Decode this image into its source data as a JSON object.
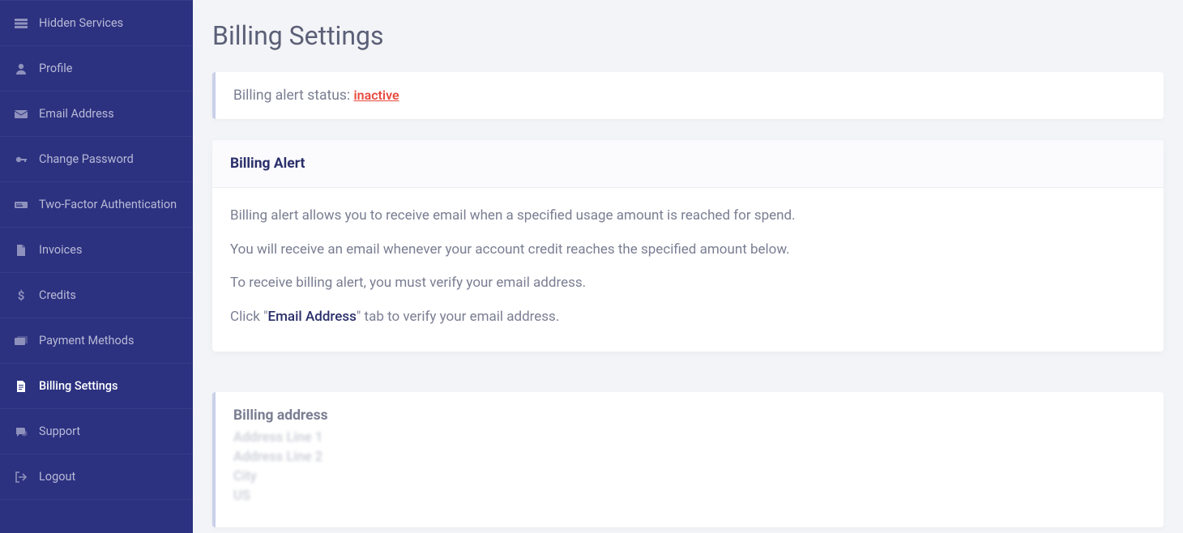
{
  "sidebar": {
    "items": [
      {
        "label": "Hidden Services",
        "icon": "server-icon",
        "active": false
      },
      {
        "label": "Profile",
        "icon": "user-icon",
        "active": false
      },
      {
        "label": "Email Address",
        "icon": "envelope-icon",
        "active": false
      },
      {
        "label": "Change Password",
        "icon": "key-icon",
        "active": false
      },
      {
        "label": "Two-Factor Authentication",
        "icon": "keyboard-icon",
        "active": false
      },
      {
        "label": "Invoices",
        "icon": "file-icon",
        "active": false
      },
      {
        "label": "Credits",
        "icon": "dollar-icon",
        "active": false
      },
      {
        "label": "Payment Methods",
        "icon": "cards-icon",
        "active": false
      },
      {
        "label": "Billing Settings",
        "icon": "document-icon",
        "active": true
      },
      {
        "label": "Support",
        "icon": "chat-icon",
        "active": false
      },
      {
        "label": "Logout",
        "icon": "logout-icon",
        "active": false
      }
    ]
  },
  "page": {
    "title": "Billing Settings",
    "alert_status_label": "Billing alert status: ",
    "alert_status_value": "inactive"
  },
  "billing_alert": {
    "header": "Billing Alert",
    "line1": "Billing alert allows you to receive email when a specified usage amount is reached for spend.",
    "line2": "You will receive an email whenever your account credit reaches the specified amount below.",
    "line3": "To receive billing alert, you must verify your email address.",
    "line4_pre": "Click \"",
    "line4_link": "Email Address",
    "line4_post": "\" tab to verify your email address."
  },
  "billing_address": {
    "header": "Billing address",
    "line1": "Address Line 1",
    "line2": "Address Line 2",
    "city": "City",
    "country": "US"
  }
}
